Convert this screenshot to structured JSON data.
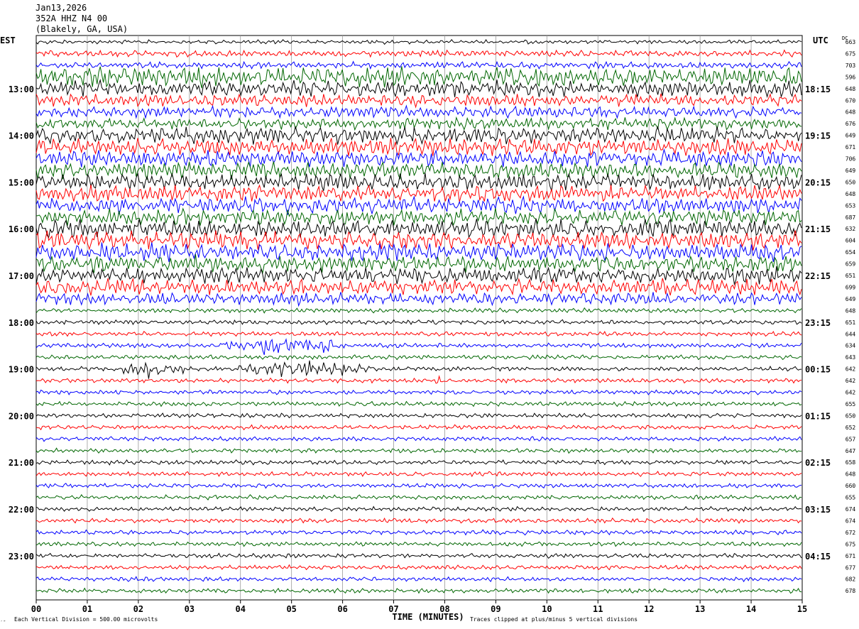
{
  "header": {
    "date": "Jan13,2026",
    "station": "352A HHZ N4 00",
    "location": "(Blakely, GA, USA)"
  },
  "labels": {
    "left_timezone": "EST",
    "right_timezone": "UTC",
    "dc_label": "DC",
    "scale_note": "Each Vertical Division =  500.00 microvolts",
    "clip_note": "Traces clipped at plus/minus 5 vertical divisions",
    "corner_mark": "′″"
  },
  "colors": {
    "cycle": [
      "#000000",
      "#ff0000",
      "#0000ff",
      "#006600"
    ],
    "grid": "#999999"
  },
  "chart_data": {
    "type": "line",
    "title": "Jan13,2026 352A HHZ N4 00 (Blakely, GA, USA)",
    "xlabel": "TIME (MINUTES)",
    "x_ticks": [
      "00",
      "01",
      "02",
      "03",
      "04",
      "05",
      "06",
      "07",
      "08",
      "09",
      "10",
      "11",
      "12",
      "13",
      "14",
      "15"
    ],
    "xlim": [
      0,
      15
    ],
    "grid": "vertical lines at each minute",
    "left_hour_labels": [
      "13:00",
      "14:00",
      "15:00",
      "16:00",
      "17:00",
      "18:00",
      "19:00",
      "20:00",
      "21:00",
      "22:00",
      "23:00"
    ],
    "right_hour_labels": [
      "18:15",
      "19:15",
      "20:15",
      "21:15",
      "22:15",
      "23:15",
      "00:15",
      "01:15",
      "02:15",
      "03:15",
      "04:15"
    ],
    "dc_offsets": [
      663,
      675,
      703,
      596,
      648,
      670,
      648,
      676,
      649,
      671,
      706,
      649,
      650,
      648,
      653,
      687,
      632,
      604,
      654,
      659,
      651,
      699,
      649,
      648,
      651,
      644,
      634,
      643,
      642,
      642,
      642,
      655,
      650,
      652,
      657,
      647,
      658,
      648,
      660,
      655,
      674,
      674,
      672,
      675,
      671,
      677,
      682,
      678
    ],
    "trace_amplitude_levels": [
      0.5,
      0.8,
      0.8,
      2.5,
      2.0,
      1.5,
      1.4,
      1.4,
      2.0,
      2.0,
      2.0,
      2.0,
      2.0,
      2.0,
      2.0,
      2.0,
      2.2,
      2.2,
      2.2,
      2.0,
      2.0,
      2.0,
      1.5,
      0.55,
      0.55,
      0.55,
      0.55,
      0.55,
      0.55,
      0.55,
      0.55,
      0.55,
      0.55,
      0.55,
      0.55,
      0.55,
      0.55,
      0.55,
      0.55,
      0.55,
      0.55,
      0.55,
      0.55,
      0.55,
      0.55,
      0.55,
      0.55,
      0.55
    ],
    "events": [
      {
        "trace": 26,
        "start_min": 3.6,
        "end_min": 6.1,
        "amplitude": 2.2
      },
      {
        "trace": 28,
        "start_min": 1.7,
        "end_min": 2.9,
        "amplitude": 2.0
      },
      {
        "trace": 28,
        "start_min": 3.8,
        "end_min": 6.6,
        "amplitude": 2.0
      },
      {
        "trace": 29,
        "start_min": 7.7,
        "end_min": 8.0,
        "amplitude": 1.6
      }
    ]
  }
}
